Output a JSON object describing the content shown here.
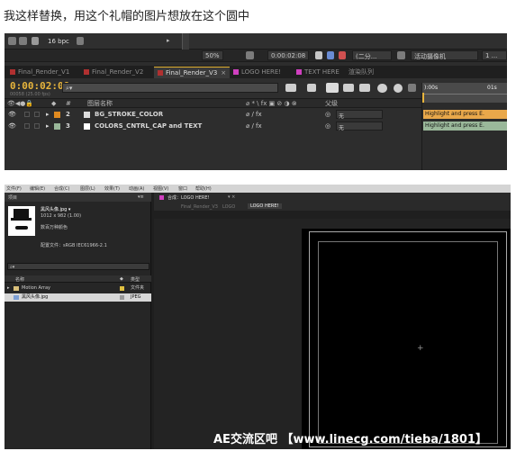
{
  "caption": "我这样替换，用这个礼帽的图片想放在这个圆中",
  "top": {
    "toolbar": {
      "bpc": "16 bpc",
      "zoom": "50%",
      "timecode": "0:00:02:08",
      "quality": "(二分...",
      "camera": "活动摄像机",
      "views": "1 ..."
    },
    "tabs": [
      {
        "label": "Final_Render_V1",
        "color": "#b03030"
      },
      {
        "label": "Final_Render_V2",
        "color": "#b03030"
      },
      {
        "label": "Final_Render_V3",
        "color": "#b03030"
      },
      {
        "label": "LOGO HERE!",
        "color": "#d040c0"
      },
      {
        "label": "TEXT HERE",
        "color": "#d040c0"
      },
      {
        "label": "渲染队列",
        "color": ""
      }
    ],
    "timecode": "0:00:02:08",
    "fps": "00058 (25.00 fps)",
    "ruler": {
      "start": "):00s",
      "end": "01s"
    },
    "columns": {
      "num": "#",
      "name": "图层名称",
      "parent": "父级"
    },
    "layers": [
      {
        "index": "2",
        "name": "BG_STROKE_COLOR",
        "parent": "无",
        "swatch": "#e08a20",
        "bar_label": "Highlight and press E.",
        "bar_color": "#e9a84a"
      },
      {
        "index": "3",
        "name": "COLORS_CNTRL_CAP and TEXT",
        "parent": "无",
        "swatch": "#ffffff",
        "bar_label": "Highlight and press E.",
        "bar_color": "#9ab89a"
      }
    ]
  },
  "bottom": {
    "menus": [
      "文件(F)",
      "编辑(E)",
      "合成(C)",
      "图层(L)",
      "效果(T)",
      "动画(A)",
      "视图(V)",
      "窗口",
      "帮助(H)"
    ],
    "project_label": "项目",
    "file": {
      "name": "黑风头像.jpg ▾",
      "size": "1012 x 982 (1.00)",
      "colors": "数百万种颜色",
      "profile": "配置文件：sRGB IEC61966-2.1"
    },
    "list_header": {
      "name": "名称",
      "type": "类型"
    },
    "items": [
      {
        "name": "Motion Array",
        "type": "文件夹",
        "selected": false
      },
      {
        "name": "黑风头像.jpg",
        "type": "JPEG",
        "selected": true
      }
    ],
    "comp_tab": "合成：LOGO HERE!",
    "breadcrumbs": [
      "Final_Render_V3",
      "LOGO",
      "LOGO HERE!"
    ],
    "watermark": "AE交流区吧 【www.linecg.com/tieba/1801】"
  }
}
